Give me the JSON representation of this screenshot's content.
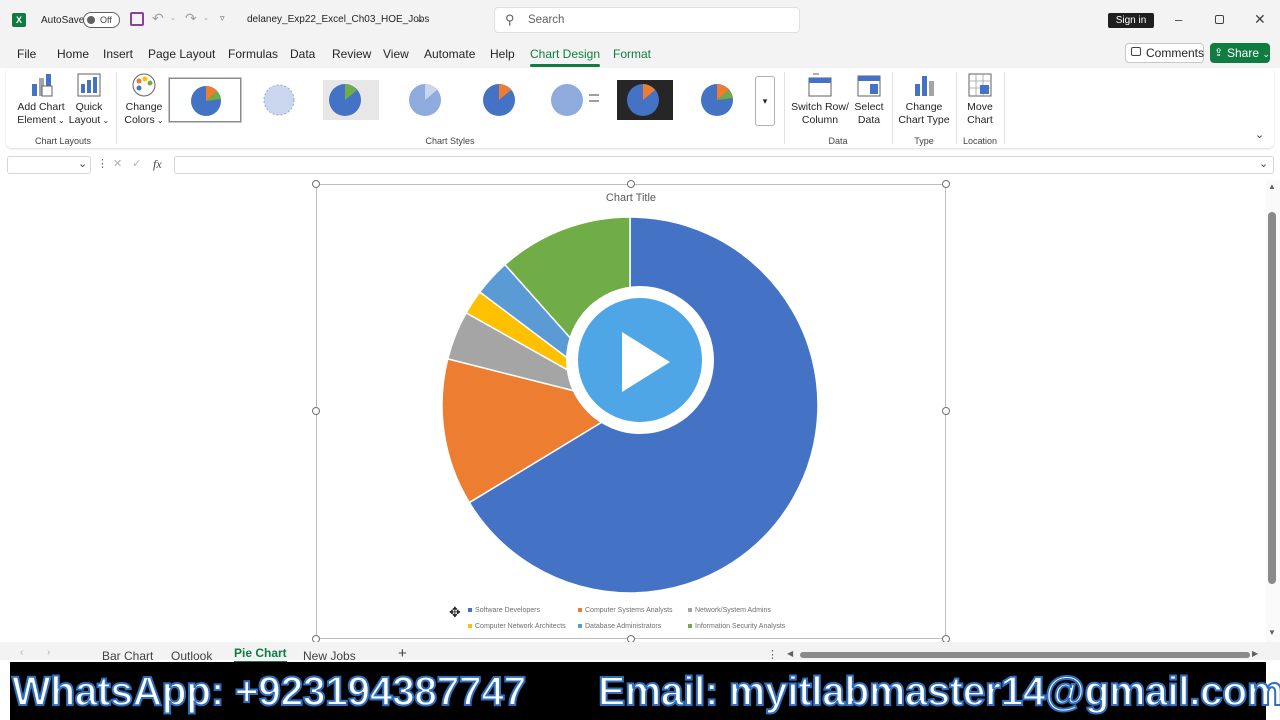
{
  "app": {
    "autosave_label": "AutoSave",
    "autosave_state": "Off",
    "filename": "delaney_Exp22_Excel_Ch03_HOE_Jobs",
    "search_placeholder": "Search",
    "signin_label": "Sign in"
  },
  "menu": {
    "tabs": [
      "File",
      "Home",
      "Insert",
      "Page Layout",
      "Formulas",
      "Data",
      "Review",
      "View",
      "Automate",
      "Help",
      "Chart Design",
      "Format"
    ],
    "active": "Chart Design",
    "comments_label": "Comments",
    "share_label": "Share"
  },
  "ribbon": {
    "add_chart_element": [
      "Add Chart",
      "Element"
    ],
    "quick_layout": [
      "Quick",
      "Layout"
    ],
    "change_colors": [
      "Change",
      "Colors"
    ],
    "switch_row_col": [
      "Switch Row/",
      "Column"
    ],
    "select_data": [
      "Select",
      "Data"
    ],
    "change_chart_type": [
      "Change",
      "Chart Type"
    ],
    "move_chart": [
      "Move",
      "Chart"
    ],
    "groups": {
      "chart_layouts": "Chart Layouts",
      "chart_styles": "Chart Styles",
      "data": "Data",
      "type": "Type",
      "location": "Location"
    }
  },
  "formula_bar": {
    "fx_label": "fx",
    "value": ""
  },
  "chart_data": {
    "type": "pie",
    "title": "Chart Title",
    "categories": [
      "Software Developers",
      "Computer Systems Analysts",
      "Network/System Admins",
      "Computer Network Architects",
      "Database Administrators",
      "Information Security Analysts"
    ],
    "values": [
      63,
      12,
      4,
      2,
      3,
      11
    ],
    "colors": [
      "#4472c4",
      "#ed7d31",
      "#a5a5a5",
      "#ffc000",
      "#5b9bd5",
      "#70ad47"
    ]
  },
  "sheet_tabs": {
    "tabs": [
      "Bar Chart",
      "Outlook",
      "Pie Chart",
      "New Jobs"
    ],
    "active": "Pie Chart"
  },
  "watermark": {
    "whatsapp": "WhatsApp: +923194387747",
    "email": "Email: myitlabmaster14@gmail.com"
  }
}
